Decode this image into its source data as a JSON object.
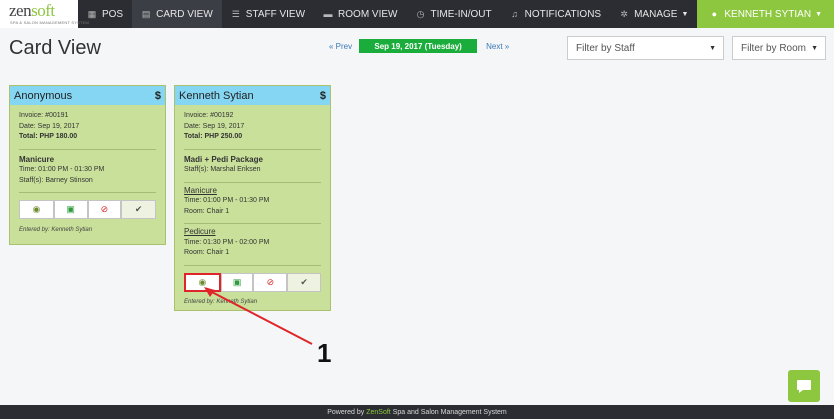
{
  "brand": {
    "name_left": "zen",
    "name_right": "soft",
    "tagline": "SPA & SALON MANAGEMENT SYSTEM"
  },
  "nav": [
    {
      "icon": "dashboard-icon",
      "label": "POS"
    },
    {
      "icon": "card-icon",
      "label": "CARD VIEW",
      "active": true
    },
    {
      "icon": "staff-icon",
      "label": "STAFF VIEW"
    },
    {
      "icon": "room-icon",
      "label": "ROOM VIEW"
    },
    {
      "icon": "clock-icon",
      "label": "TIME-IN/OUT"
    },
    {
      "icon": "bell-icon",
      "label": "NOTIFICATIONS"
    },
    {
      "icon": "gear-icon",
      "label": "MANAGE"
    }
  ],
  "user": {
    "name": "KENNETH SYTIAN"
  },
  "page": {
    "title": "Card View"
  },
  "datebar": {
    "prev": "« Prev",
    "date": "Sep 19, 2017 (Tuesday)",
    "next": "Next »"
  },
  "filters": {
    "staff": "Filter by Staff",
    "room": "Filter by Room"
  },
  "cards": [
    {
      "name": "Anonymous",
      "currency": "$",
      "invoice": "Invoice: #00191",
      "date": "Date: Sep 19, 2017",
      "total": "Total: PHP 180.00",
      "service": "Manicure",
      "time": "Time: 01:00 PM - 01:30 PM",
      "staff": "Staff(s): Barney Stinson",
      "entered": "Entered by: Kenneth Sytian"
    },
    {
      "name": "Kenneth Sytian",
      "currency": "$",
      "invoice": "Invoice: #00192",
      "date": "Date: Sep 19, 2017",
      "total": "Total: PHP 250.00",
      "package": "Madi + Pedi Package",
      "package_staff": "Staff(s): Marshal Eriksen",
      "services": [
        {
          "name": "Manicure",
          "time": "Time: 01:00 PM - 01:30 PM",
          "room": "Room: Chair 1"
        },
        {
          "name": "Pedicure",
          "time": "Time: 01:30 PM - 02:00 PM",
          "room": "Room: Chair 1"
        }
      ],
      "entered": "Entered by: Kenneth Sytian"
    }
  ],
  "annotation": {
    "number": "1",
    "color": "#e0252a"
  },
  "footer": {
    "prefix": "Powered by",
    "brand": "ZenSoft",
    "suffix": "Spa and Salon Management System"
  },
  "colors": {
    "accent": "#8dc63f",
    "card": "#c9e09a",
    "card_header": "#85d6f2",
    "date": "#1bad3b"
  }
}
